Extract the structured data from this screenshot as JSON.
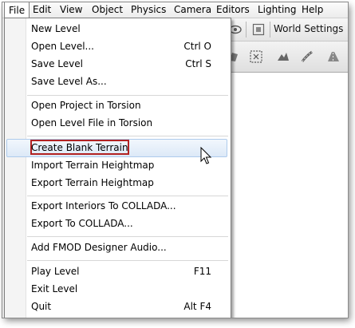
{
  "menubar": {
    "items": [
      "File",
      "Edit",
      "View",
      "Object",
      "Physics",
      "Camera",
      "Editors",
      "Lighting",
      "Help"
    ]
  },
  "toolbar": {
    "world_settings_label": "World Settings"
  },
  "file_menu": {
    "items": [
      {
        "label": "New Level",
        "shortcut": ""
      },
      {
        "label": "Open Level...",
        "shortcut": "Ctrl O"
      },
      {
        "label": "Save Level",
        "shortcut": "Ctrl S"
      },
      {
        "label": "Save Level As...",
        "shortcut": ""
      },
      {
        "label": "Open Project in Torsion",
        "shortcut": ""
      },
      {
        "label": "Open Level File in Torsion",
        "shortcut": ""
      },
      {
        "label": "Create Blank Terrain",
        "shortcut": ""
      },
      {
        "label": "Import Terrain Heightmap",
        "shortcut": ""
      },
      {
        "label": "Export Terrain Heightmap",
        "shortcut": ""
      },
      {
        "label": "Export Interiors To COLLADA...",
        "shortcut": ""
      },
      {
        "label": "Export To COLLADA...",
        "shortcut": ""
      },
      {
        "label": "Add FMOD Designer Audio...",
        "shortcut": ""
      },
      {
        "label": "Play Level",
        "shortcut": "F11"
      },
      {
        "label": "Exit Level",
        "shortcut": ""
      },
      {
        "label": "Quit",
        "shortcut": "Alt F4"
      }
    ],
    "highlighted_item": "Create Blank Terrain"
  },
  "colors": {
    "highlight_outline": "#b22222",
    "hover_background": "#dde9f7"
  }
}
